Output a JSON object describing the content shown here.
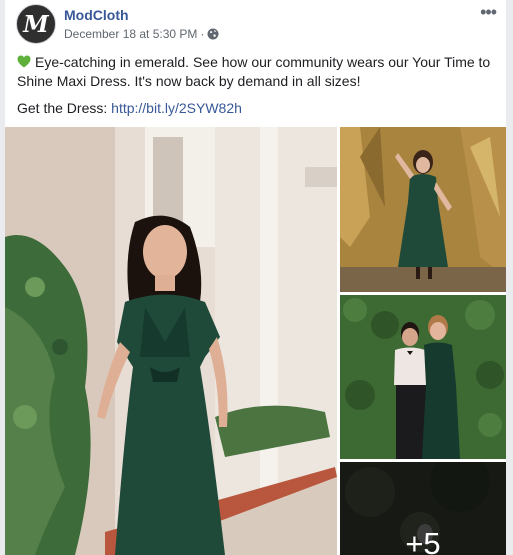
{
  "post": {
    "page_name": "ModCloth",
    "avatar_letter": "M",
    "timestamp": "December 18 at 5:30 PM",
    "separator": "·",
    "privacy_icon": "globe-icon",
    "more_label": "•••",
    "text": "Eye-catching in emerald. See how our community wears our Your Time to Shine Maxi Dress. It's now back by demand in all sizes!",
    "link_prefix": "Get the Dress:",
    "link_text": "http://bit.ly/2SYW82h",
    "emoji_icon": "green-heart-icon"
  },
  "gallery": {
    "more_count": "+5"
  },
  "colors": {
    "link": "#385898",
    "meta": "#606770",
    "text": "#1c1e21",
    "emerald": "#1f4a3a"
  }
}
